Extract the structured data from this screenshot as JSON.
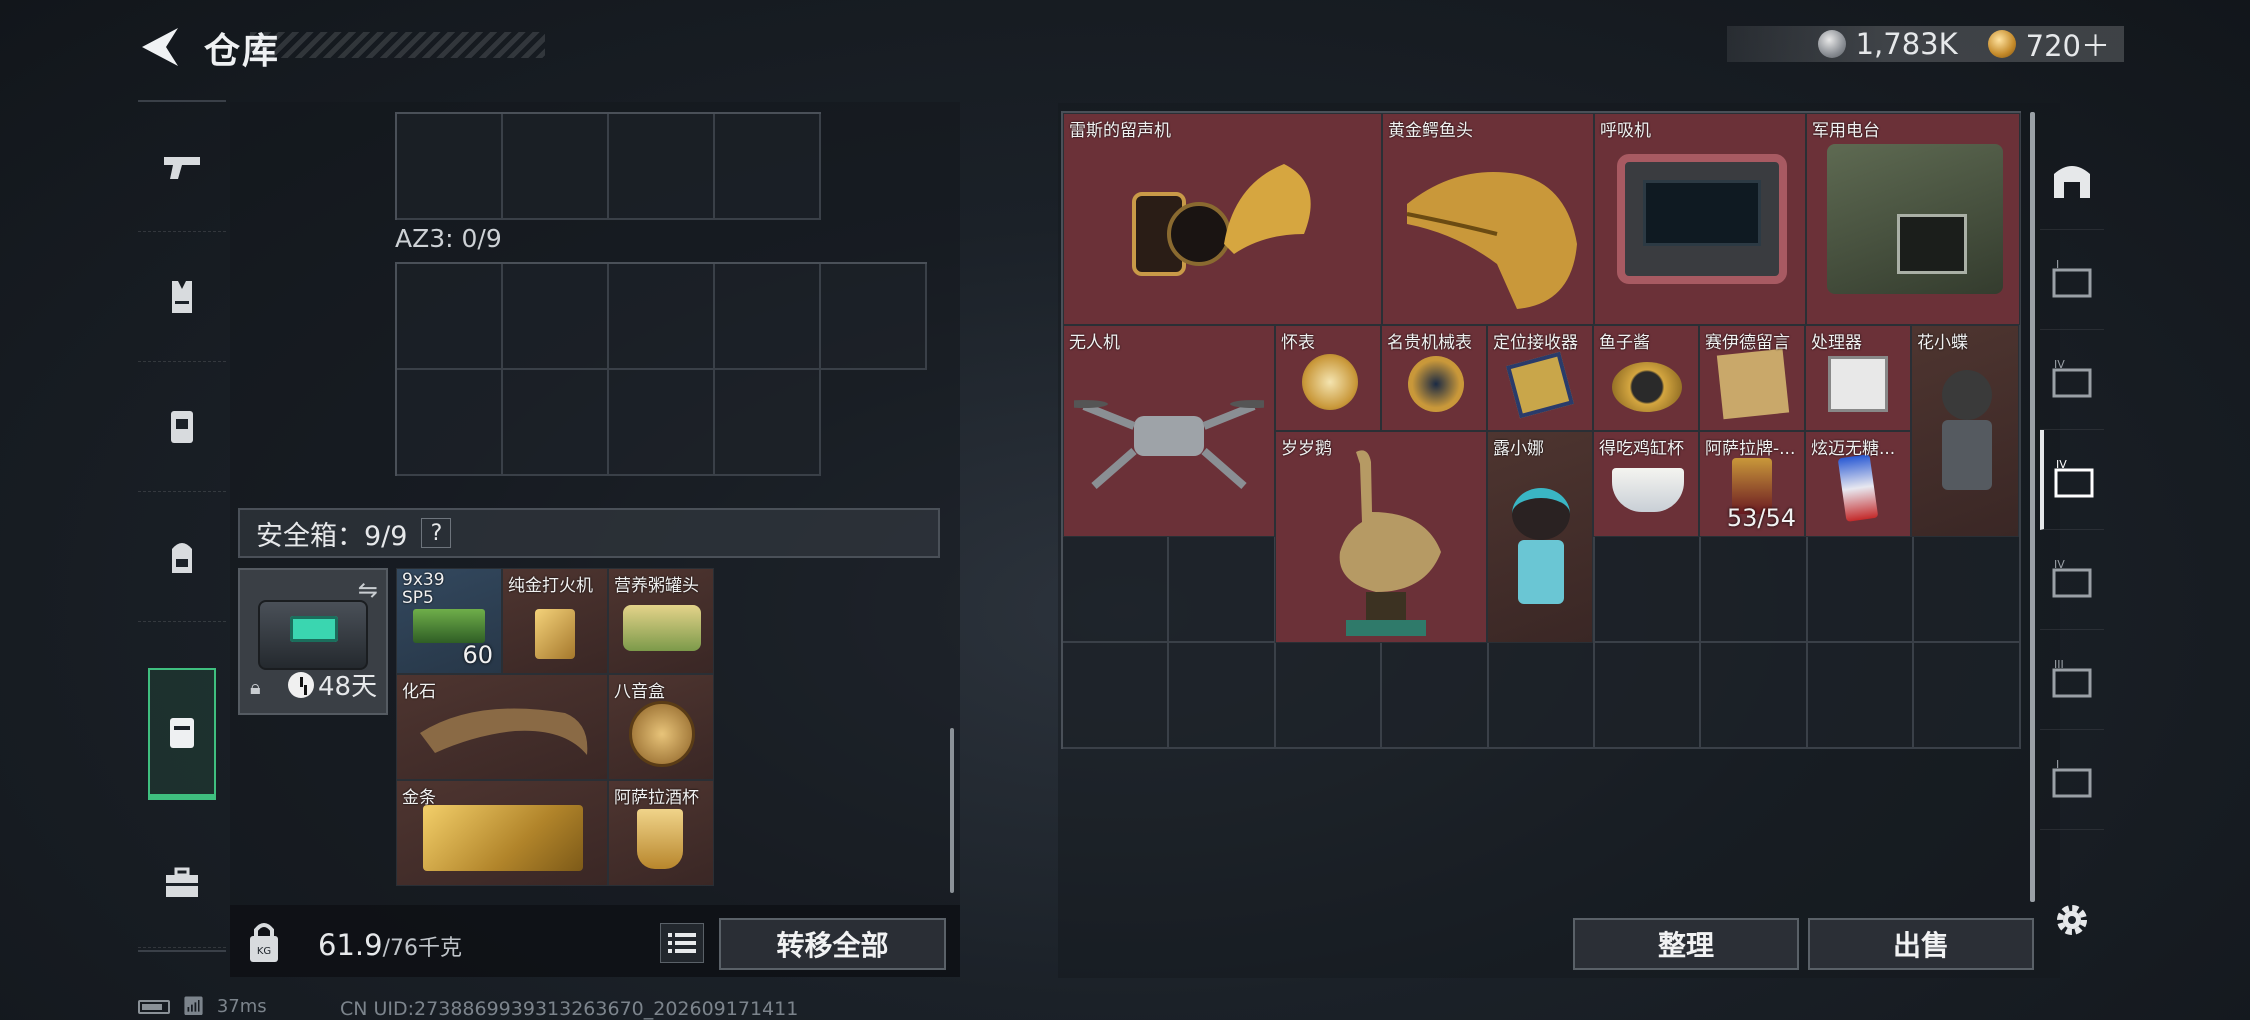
{
  "header": {
    "title": "仓库",
    "back_icon": "back-arrow-icon",
    "currencies": [
      {
        "icon": "silver-coin-icon",
        "value": "1,783K"
      },
      {
        "icon": "gold-coin-icon",
        "value": "720＋"
      }
    ]
  },
  "left_nav": {
    "items": [
      {
        "name": "weapons",
        "icon": "pistol-icon"
      },
      {
        "name": "armor",
        "icon": "vest-icon"
      },
      {
        "name": "rig",
        "icon": "chest-rig-icon"
      },
      {
        "name": "backpack",
        "icon": "backpack-icon"
      },
      {
        "name": "safe-box",
        "icon": "case-icon",
        "active": true
      },
      {
        "name": "toolbox",
        "icon": "toolbox-icon"
      }
    ]
  },
  "container": {
    "az3_label": "AZ3: 0/9",
    "safe_box_label": "安全箱：9/9",
    "help_label": "?",
    "safe_box_timer": "48天",
    "items": [
      {
        "name": "9x39 SP5",
        "count": "60"
      },
      {
        "name": "纯金打火机"
      },
      {
        "name": "营养粥罐头"
      },
      {
        "name": "化石"
      },
      {
        "name": "八音盒"
      },
      {
        "name": "金条"
      },
      {
        "name": "阿萨拉酒杯"
      }
    ]
  },
  "footer_left": {
    "weight_current": "61.9",
    "weight_capacity": "/76千克",
    "transfer_all": "转移全部"
  },
  "stash": {
    "items": [
      {
        "name": "雷斯的留声机"
      },
      {
        "name": "黄金鳄鱼头"
      },
      {
        "name": "呼吸机"
      },
      {
        "name": "军用电台"
      },
      {
        "name": "无人机"
      },
      {
        "name": "怀表"
      },
      {
        "name": "名贵机械表"
      },
      {
        "name": "定位接收器"
      },
      {
        "name": "鱼子酱"
      },
      {
        "name": "赛伊德留言"
      },
      {
        "name": "处理器"
      },
      {
        "name": "花小蝶"
      },
      {
        "name": "岁岁鹅"
      },
      {
        "name": "露小娜"
      },
      {
        "name": "得吃鸡缸杯"
      },
      {
        "name": "阿萨拉牌-...",
        "count": "53/54"
      },
      {
        "name": "炫迈无糖..."
      }
    ],
    "sort_label": "整理",
    "sell_label": "出售"
  },
  "right_nav": {
    "items": [
      {
        "icon": "stash-arch-icon"
      },
      {
        "icon": "tier-i-stash-icon"
      },
      {
        "icon": "tier-ii-stash-icon"
      },
      {
        "icon": "tier-iii-stash-icon",
        "active": true
      },
      {
        "icon": "tier-iv-stash-icon"
      },
      {
        "icon": "tier-v-stash-icon"
      },
      {
        "icon": "tier-vi-stash-icon"
      }
    ],
    "settings_icon": "gear-icon"
  },
  "status": {
    "ping": "37ms",
    "uid": "CN UID:2738869939313263670_202609171411"
  },
  "colors": {
    "active_green": "#3fbf7f",
    "legendary_red": "#6b3138",
    "epic_brown": "#4e3530",
    "rare_blue": "#33485e"
  }
}
